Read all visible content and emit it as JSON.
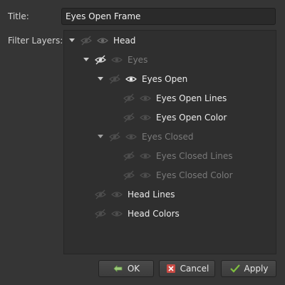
{
  "title_label": "Title:",
  "title_value": "Eyes Open Frame",
  "filter_label": "Filter Layers:",
  "layers": [
    {
      "name": "Head",
      "expanded": true,
      "hidden_toggle": "off",
      "visible": true,
      "dim": false
    },
    {
      "name": "Eyes",
      "expanded": true,
      "hidden_toggle": "on",
      "visible": false,
      "dim": true
    },
    {
      "name": "Eyes Open",
      "expanded": true,
      "hidden_toggle": "off",
      "visible": true,
      "dim": false
    },
    {
      "name": "Eyes Open Lines",
      "hidden_toggle": "off",
      "visible": false,
      "dim": false
    },
    {
      "name": "Eyes Open Color",
      "hidden_toggle": "off",
      "visible": false,
      "dim": false
    },
    {
      "name": "Eyes Closed",
      "expanded": true,
      "hidden_toggle": "off",
      "visible": false,
      "dim": true
    },
    {
      "name": "Eyes Closed Lines",
      "hidden_toggle": "off",
      "visible": false,
      "dim": true
    },
    {
      "name": "Eyes Closed Color",
      "hidden_toggle": "off",
      "visible": false,
      "dim": true
    },
    {
      "name": "Head Lines",
      "hidden_toggle": "off",
      "visible": false,
      "dim": false
    },
    {
      "name": "Head Colors",
      "hidden_toggle": "off",
      "visible": false,
      "dim": false
    }
  ],
  "buttons": {
    "ok": "OK",
    "cancel": "Cancel",
    "apply": "Apply"
  },
  "colors": {
    "background": "#353535",
    "tree_background": "#2f2f2f",
    "text_bright": "#ececec",
    "text_dim": "#7a7a7a",
    "ok_icon": "#9bc97a",
    "cancel_icon": "#d9534f",
    "apply_icon": "#7fbf3f"
  }
}
